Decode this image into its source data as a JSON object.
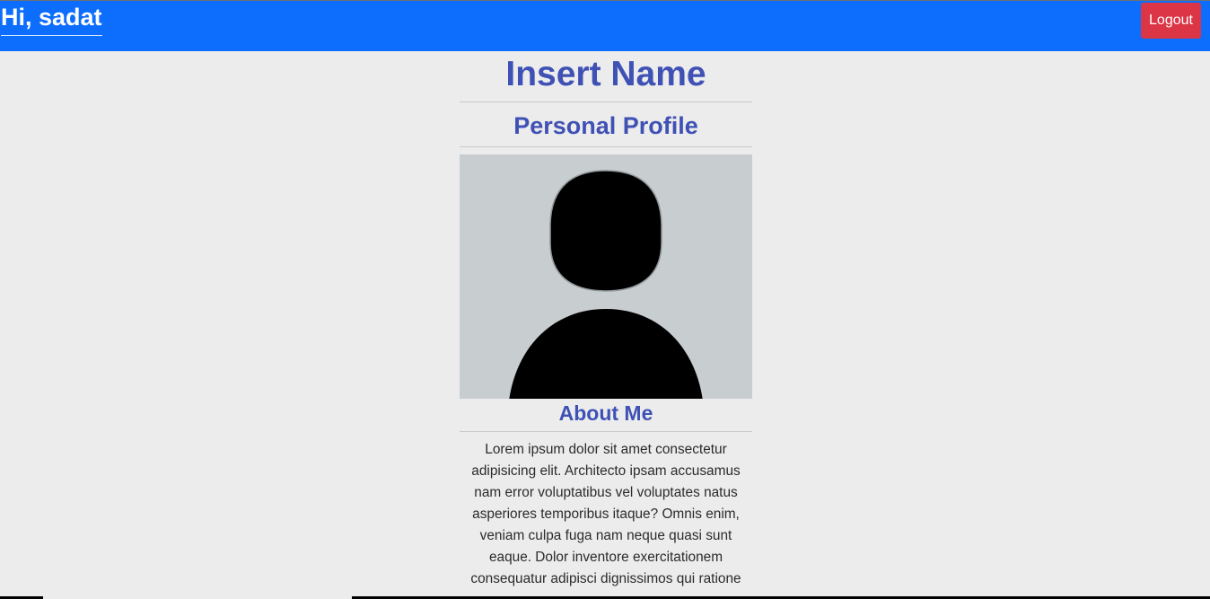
{
  "header": {
    "greeting": "Hi, sadat",
    "logout_label": "Logout",
    "background_color": "#0d6efd",
    "logout_color": "#dc3545"
  },
  "profile": {
    "name": "Insert Name",
    "subtitle": "Personal Profile",
    "avatar_icon": "person-silhouette-icon",
    "about_title": "About Me",
    "about_text": "Lorem ipsum dolor sit amet consectetur adipisicing elit. Architecto ipsam accusamus nam error voluptatibus vel voluptates natus asperiores temporibus itaque? Omnis enim, veniam culpa fuga nam neque quasi sunt eaque. Dolor inventore exercitationem consequatur adipisci dignissimos qui ratione",
    "heading_color": "#3f51b5"
  }
}
